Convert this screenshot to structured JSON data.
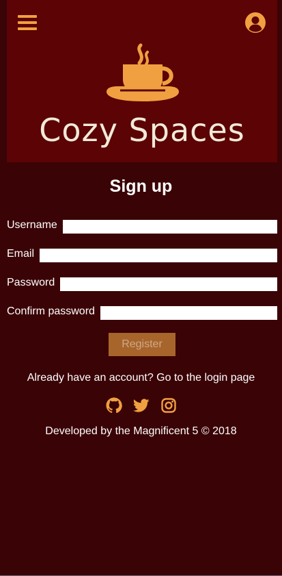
{
  "header": {
    "brand": "Cozy Spaces",
    "menu_icon": "hamburger-menu-icon",
    "user_icon": "user-circle-icon",
    "logo_icon": "coffee-cup-icon"
  },
  "form": {
    "title": "Sign up",
    "fields": [
      {
        "label": "Username",
        "value": ""
      },
      {
        "label": "Email",
        "value": ""
      },
      {
        "label": "Password",
        "value": ""
      },
      {
        "label": "Confirm password",
        "value": ""
      }
    ],
    "register_label": "Register"
  },
  "login": {
    "prompt": "Already have an account?",
    "link_text": "Go to the login page"
  },
  "social": [
    "github-icon",
    "twitter-icon",
    "instagram-icon"
  ],
  "footer": {
    "text": "Developed by the Magnificent 5 © 2018"
  },
  "colors": {
    "background": "#3a0306",
    "header_background": "#5b0305",
    "accent": "#f0a040",
    "button": "#a8652b"
  }
}
